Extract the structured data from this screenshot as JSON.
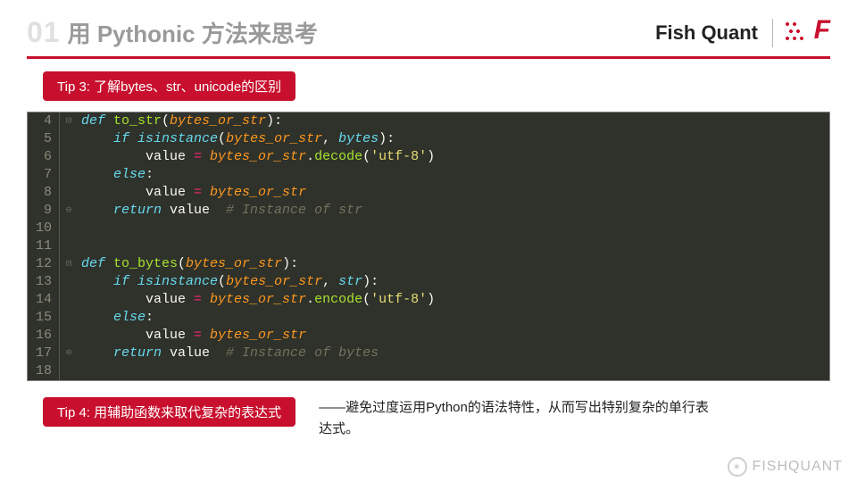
{
  "header": {
    "chapter_num": "01",
    "chapter_title": "用 Pythonic 方法来思考",
    "brand": "Fish Quant"
  },
  "tip3": {
    "label": "Tip 3: 了解bytes、str、unicode的区别"
  },
  "code": {
    "lines": [
      {
        "n": "4",
        "g": "⊟",
        "tokens": [
          [
            "kw",
            "def "
          ],
          [
            "fn",
            "to_str"
          ],
          [
            "var",
            "("
          ],
          [
            "arg",
            "bytes_or_str"
          ],
          [
            "var",
            "):"
          ]
        ]
      },
      {
        "n": "5",
        "g": "",
        "tokens": [
          [
            "var",
            "    "
          ],
          [
            "kw",
            "if "
          ],
          [
            "type",
            "isinstance"
          ],
          [
            "var",
            "("
          ],
          [
            "arg",
            "bytes_or_str"
          ],
          [
            "var",
            ", "
          ],
          [
            "type",
            "bytes"
          ],
          [
            "var",
            "):"
          ]
        ]
      },
      {
        "n": "6",
        "g": "",
        "tokens": [
          [
            "var",
            "        value "
          ],
          [
            "op",
            "= "
          ],
          [
            "arg",
            "bytes_or_str"
          ],
          [
            "var",
            "."
          ],
          [
            "fn",
            "decode"
          ],
          [
            "var",
            "("
          ],
          [
            "str",
            "'utf-8'"
          ],
          [
            "var",
            ")"
          ]
        ]
      },
      {
        "n": "7",
        "g": "",
        "tokens": [
          [
            "var",
            "    "
          ],
          [
            "kw",
            "else"
          ],
          [
            "var",
            ":"
          ]
        ]
      },
      {
        "n": "8",
        "g": "",
        "tokens": [
          [
            "var",
            "        value "
          ],
          [
            "op",
            "= "
          ],
          [
            "arg",
            "bytes_or_str"
          ]
        ]
      },
      {
        "n": "9",
        "g": "⊖",
        "tokens": [
          [
            "var",
            "    "
          ],
          [
            "kw",
            "return "
          ],
          [
            "var",
            "value  "
          ],
          [
            "cmt",
            "# Instance of str"
          ]
        ]
      },
      {
        "n": "10",
        "g": "",
        "tokens": [
          [
            "var",
            ""
          ]
        ]
      },
      {
        "n": "11",
        "g": "",
        "tokens": [
          [
            "var",
            ""
          ]
        ]
      },
      {
        "n": "12",
        "g": "⊟",
        "tokens": [
          [
            "kw",
            "def "
          ],
          [
            "fn",
            "to_bytes"
          ],
          [
            "var",
            "("
          ],
          [
            "arg",
            "bytes_or_str"
          ],
          [
            "var",
            "):"
          ]
        ]
      },
      {
        "n": "13",
        "g": "",
        "tokens": [
          [
            "var",
            "    "
          ],
          [
            "kw",
            "if "
          ],
          [
            "type",
            "isinstance"
          ],
          [
            "var",
            "("
          ],
          [
            "arg",
            "bytes_or_str"
          ],
          [
            "var",
            ", "
          ],
          [
            "type",
            "str"
          ],
          [
            "var",
            "):"
          ]
        ]
      },
      {
        "n": "14",
        "g": "",
        "tokens": [
          [
            "var",
            "        value "
          ],
          [
            "op",
            "= "
          ],
          [
            "arg",
            "bytes_or_str"
          ],
          [
            "var",
            "."
          ],
          [
            "fn",
            "encode"
          ],
          [
            "var",
            "("
          ],
          [
            "str",
            "'utf-8'"
          ],
          [
            "var",
            ")"
          ]
        ]
      },
      {
        "n": "15",
        "g": "",
        "tokens": [
          [
            "var",
            "    "
          ],
          [
            "kw",
            "else"
          ],
          [
            "var",
            ":"
          ]
        ]
      },
      {
        "n": "16",
        "g": "",
        "tokens": [
          [
            "var",
            "        value "
          ],
          [
            "op",
            "= "
          ],
          [
            "arg",
            "bytes_or_str"
          ]
        ]
      },
      {
        "n": "17",
        "g": "⊖",
        "tokens": [
          [
            "var",
            "    "
          ],
          [
            "kw",
            "return "
          ],
          [
            "var",
            "value  "
          ],
          [
            "cmt",
            "# Instance of bytes"
          ]
        ]
      },
      {
        "n": "18",
        "g": "",
        "tokens": [
          [
            "var",
            ""
          ]
        ]
      }
    ]
  },
  "tip4": {
    "label": "Tip 4: 用辅助函数来取代复杂的表达式",
    "description": "——避免过度运用Python的语法特性，从而写出特别复杂的单行表达式。"
  },
  "watermark": {
    "text": "FISHQUANT"
  }
}
